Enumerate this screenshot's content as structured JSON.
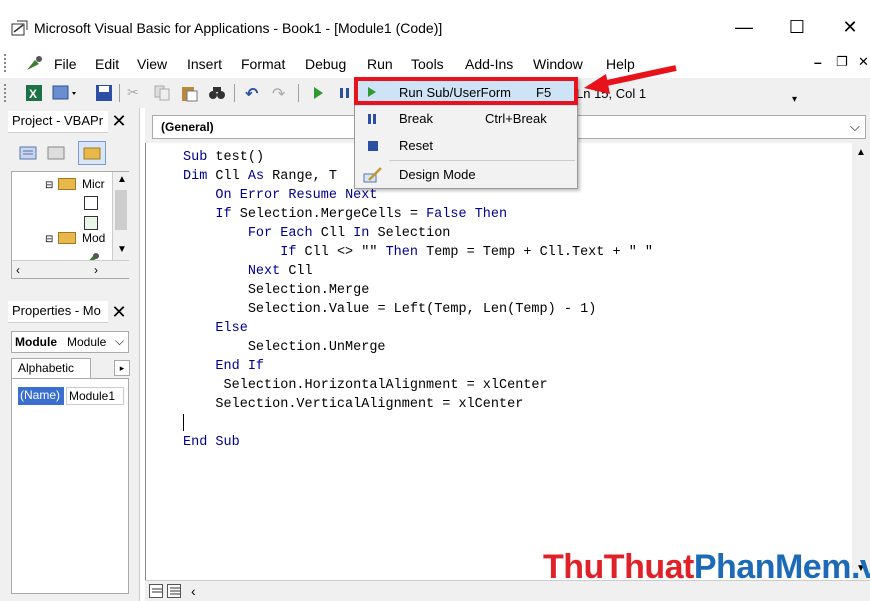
{
  "window": {
    "title": "Microsoft Visual Basic for Applications - Book1 - [Module1 (Code)]",
    "minimize": "—",
    "maximize": "☐",
    "close": "✕"
  },
  "menubar": {
    "items": [
      "File",
      "Edit",
      "View",
      "Insert",
      "Format",
      "Debug",
      "Run",
      "Tools",
      "Add-Ins",
      "Window",
      "Help"
    ],
    "right_controls": [
      "–",
      "❐",
      "✕"
    ]
  },
  "toolbar": {
    "position": "Ln 15, Col 1"
  },
  "run_menu": {
    "items": [
      {
        "label": "Run Sub/UserForm",
        "shortcut": "F5",
        "icon": "play-icon"
      },
      {
        "label": "Break",
        "shortcut": "Ctrl+Break",
        "icon": "pause-icon"
      },
      {
        "label": "Reset",
        "shortcut": "",
        "icon": "stop-icon"
      },
      {
        "label": "Design Mode",
        "shortcut": "",
        "icon": "design-mode-icon"
      }
    ]
  },
  "project_panel": {
    "title": "Project - VBAPr",
    "tree": [
      "Micr",
      "Mod"
    ]
  },
  "properties_panel": {
    "title": "Properties - Mo",
    "object_label": "Module",
    "object_type": "Module",
    "tab": "Alphabetic",
    "prop_name": "(Name)",
    "prop_value": "Module1"
  },
  "code_editor": {
    "object_dropdown": "(General)",
    "lines": [
      "Sub test()",
      "Dim Cll As Range, T",
      "    On Error Resume Next",
      "    If Selection.MergeCells = False Then",
      "        For Each Cll In Selection",
      "            If Cll <> \"\" Then Temp = Temp + Cll.Text + \" \"",
      "        Next Cll",
      "        Selection.Merge",
      "        Selection.Value = Left(Temp, Len(Temp) - 1)",
      "    Else",
      "        Selection.UnMerge",
      "    End If",
      "     Selection.HorizontalAlignment = xlCenter",
      "    Selection.VerticalAlignment = xlCenter",
      "",
      "End Sub"
    ]
  },
  "watermark": {
    "part1": "ThuThuat",
    "part2": "PhanMem",
    "part3": ".vn"
  },
  "colors": {
    "highlight": "#e8121b",
    "keyword": "#00008b",
    "watermark_red": "#e02128",
    "watermark_blue": "#1d6bb6"
  }
}
